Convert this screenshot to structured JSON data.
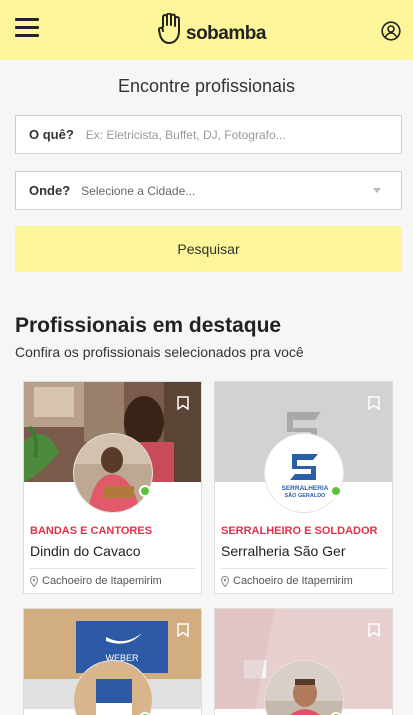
{
  "header": {
    "brand": "sobamba",
    "menu_icon": "hamburger-icon",
    "user_icon": "user-circle-icon",
    "background": "#fdf59a"
  },
  "search": {
    "title": "Encontre profissionais",
    "what_label": "O quê?",
    "what_placeholder": "Ex: Eletricista, Buffet, DJ, Fotografo...",
    "where_label": "Onde?",
    "where_value": "Selecione a Cidade...",
    "button_label": "Pesquisar"
  },
  "featured": {
    "title": "Profissionais em destaque",
    "subtitle": "Confira os profissionais selecionados pra você",
    "cards": [
      {
        "category": "BANDAS E CANTORES",
        "name": "Dindin do Cavaco",
        "location": "Cachoeiro de Itapemirim"
      },
      {
        "category": "SERRALHEIRO E SOLDADOR",
        "name": "Serralheria São Ger",
        "location": "Cachoeiro de Itapemirim"
      },
      {
        "category": "",
        "name": "",
        "location": ""
      },
      {
        "category": "",
        "name": "",
        "location": ""
      }
    ],
    "logo_text_1": "SERRALHERIA",
    "logo_text_2": "SÃO GERALDO",
    "weber_text": "WEBER"
  },
  "colors": {
    "accent_yellow": "#fdf59a",
    "category_red": "#e0324a",
    "verified_green": "#58c23a"
  }
}
